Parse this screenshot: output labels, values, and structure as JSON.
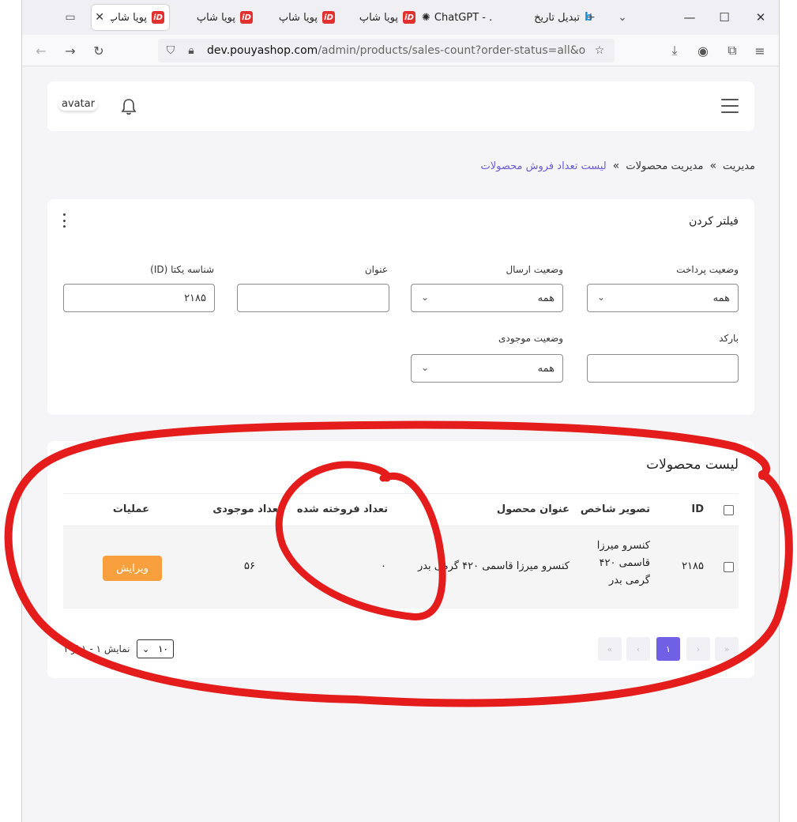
{
  "browser": {
    "tabs": [
      {
        "label": "پویا شاپ",
        "active": true
      },
      {
        "label": "پویا شاپ",
        "active": false
      },
      {
        "label": "پویا شاپ",
        "active": false
      },
      {
        "label": "پویا شاپ",
        "active": false
      },
      {
        "label": "ChatGPT - ...",
        "active": false
      },
      {
        "label": "تبدیل تاریخ",
        "active": false
      }
    ],
    "favicon_text": "iD",
    "url_domain": "dev.pouyashop.com",
    "url_path": "/admin/products/sales-count?order-status=all&order-shipping"
  },
  "header": {
    "avatar": "avatar"
  },
  "breadcrumb": {
    "items": [
      "مدیریت",
      "مدیریت محصولات",
      "لیست تعداد فروش محصولات"
    ],
    "separator": "»"
  },
  "filter": {
    "title": "فیلتر کردن",
    "fields": {
      "payment_status": {
        "label": "وضعیت پرداخت",
        "value": "همه"
      },
      "shipping_status": {
        "label": "وضعیت ارسال",
        "value": "همه"
      },
      "title": {
        "label": "عنوان",
        "value": ""
      },
      "id": {
        "label": "شناسه یکتا (ID)",
        "value": "۲۱۸۵"
      },
      "barcode": {
        "label": "بارکد",
        "value": ""
      },
      "stock_status": {
        "label": "وضعیت موجودی",
        "value": "همه"
      }
    }
  },
  "products": {
    "title": "لیست محصولات",
    "columns": [
      "ID",
      "تصویر شاخص",
      "عنوان محصول",
      "تعداد فروخته شده",
      "تعداد موجودی",
      "عملیات"
    ],
    "rows": [
      {
        "id": "۲۱۸۵",
        "image_alt": "کنسرو میرزا قاسمی ۴۲۰ گرمی بدر",
        "title": "کنسرو میرزا قاسمی ۴۲۰ گرمی بدر",
        "sold": "۰",
        "stock": "۵۶",
        "action": "ویرایش"
      }
    ],
    "pagination": {
      "first": "«",
      "prev": "‹",
      "current": "۱",
      "next": "›",
      "last": "»",
      "per_page": "۱۰",
      "summary": "نمایش ۱ - ۱ از ۱"
    }
  },
  "colors": {
    "accent": "#6f60e5",
    "edit_button": "#f8a03d",
    "annotation": "#e41c1c"
  }
}
